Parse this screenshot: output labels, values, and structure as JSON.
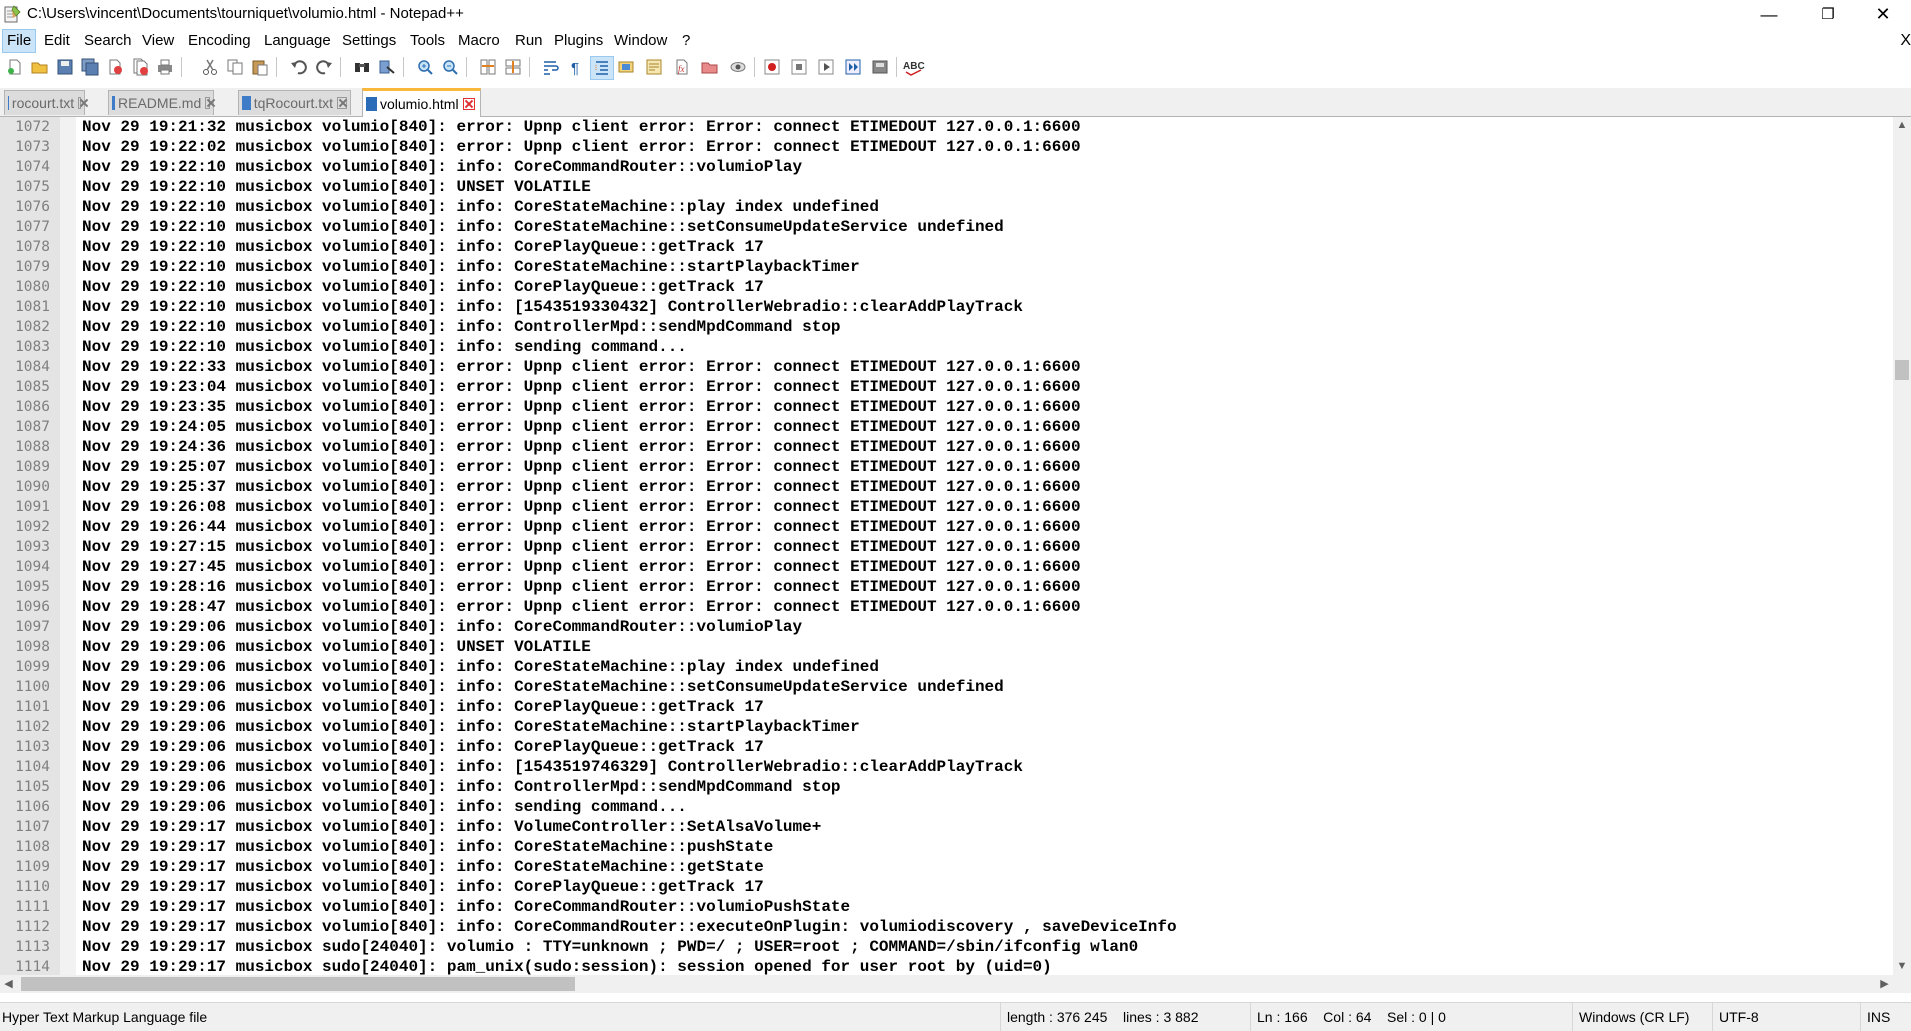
{
  "window": {
    "title": "C:\\Users\\vincent\\Documents\\tourniquet\\volumio.html - Notepad++",
    "minimize": "—",
    "maximize": "❐",
    "close": "✕"
  },
  "menu": {
    "items": [
      "File",
      "Edit",
      "Search",
      "View",
      "Encoding",
      "Language",
      "Settings",
      "Tools",
      "Macro",
      "Run",
      "Plugins",
      "Window",
      "?"
    ],
    "close_doc": "X"
  },
  "toolbar": {
    "icons": [
      "new-file",
      "open-file",
      "save",
      "save-all",
      "close",
      "close-all",
      "print",
      "cut",
      "copy",
      "paste",
      "undo",
      "redo",
      "find",
      "replace",
      "zoom-in",
      "zoom-out",
      "sync-vertical",
      "sync-horizontal",
      "word-wrap",
      "show-all-chars",
      "indent-guide",
      "user-defined-lang",
      "doc-map",
      "function-list",
      "folder-as-workspace",
      "monitoring",
      "record-macro",
      "stop-record",
      "play-macro",
      "run-macro-multiple",
      "save-macro",
      "spell-check"
    ]
  },
  "tabs": [
    {
      "label": "rocourt.txt",
      "active": false
    },
    {
      "label": "README.md",
      "active": false
    },
    {
      "label": "tqRocourt.txt",
      "active": false
    },
    {
      "label": "volumio.html",
      "active": true
    }
  ],
  "editor": {
    "lines": [
      {
        "n": "1072",
        "text": "Nov 29 19:21:32 musicbox volumio[840]: error: Upnp client error: Error: connect ETIMEDOUT 127.0.0.1:6600"
      },
      {
        "n": "1073",
        "text": "Nov 29 19:22:02 musicbox volumio[840]: error: Upnp client error: Error: connect ETIMEDOUT 127.0.0.1:6600"
      },
      {
        "n": "1074",
        "text": "Nov 29 19:22:10 musicbox volumio[840]: info: CoreCommandRouter::volumioPlay"
      },
      {
        "n": "1075",
        "text": "Nov 29 19:22:10 musicbox volumio[840]: UNSET VOLATILE"
      },
      {
        "n": "1076",
        "text": "Nov 29 19:22:10 musicbox volumio[840]: info: CoreStateMachine::play index undefined"
      },
      {
        "n": "1077",
        "text": "Nov 29 19:22:10 musicbox volumio[840]: info: CoreStateMachine::setConsumeUpdateService undefined"
      },
      {
        "n": "1078",
        "text": "Nov 29 19:22:10 musicbox volumio[840]: info: CorePlayQueue::getTrack 17"
      },
      {
        "n": "1079",
        "text": "Nov 29 19:22:10 musicbox volumio[840]: info: CoreStateMachine::startPlaybackTimer"
      },
      {
        "n": "1080",
        "text": "Nov 29 19:22:10 musicbox volumio[840]: info: CorePlayQueue::getTrack 17"
      },
      {
        "n": "1081",
        "text": "Nov 29 19:22:10 musicbox volumio[840]: info: [1543519330432] ControllerWebradio::clearAddPlayTrack"
      },
      {
        "n": "1082",
        "text": "Nov 29 19:22:10 musicbox volumio[840]: info: ControllerMpd::sendMpdCommand stop"
      },
      {
        "n": "1083",
        "text": "Nov 29 19:22:10 musicbox volumio[840]: info: sending command..."
      },
      {
        "n": "1084",
        "text": "Nov 29 19:22:33 musicbox volumio[840]: error: Upnp client error: Error: connect ETIMEDOUT 127.0.0.1:6600"
      },
      {
        "n": "1085",
        "text": "Nov 29 19:23:04 musicbox volumio[840]: error: Upnp client error: Error: connect ETIMEDOUT 127.0.0.1:6600"
      },
      {
        "n": "1086",
        "text": "Nov 29 19:23:35 musicbox volumio[840]: error: Upnp client error: Error: connect ETIMEDOUT 127.0.0.1:6600"
      },
      {
        "n": "1087",
        "text": "Nov 29 19:24:05 musicbox volumio[840]: error: Upnp client error: Error: connect ETIMEDOUT 127.0.0.1:6600"
      },
      {
        "n": "1088",
        "text": "Nov 29 19:24:36 musicbox volumio[840]: error: Upnp client error: Error: connect ETIMEDOUT 127.0.0.1:6600"
      },
      {
        "n": "1089",
        "text": "Nov 29 19:25:07 musicbox volumio[840]: error: Upnp client error: Error: connect ETIMEDOUT 127.0.0.1:6600"
      },
      {
        "n": "1090",
        "text": "Nov 29 19:25:37 musicbox volumio[840]: error: Upnp client error: Error: connect ETIMEDOUT 127.0.0.1:6600"
      },
      {
        "n": "1091",
        "text": "Nov 29 19:26:08 musicbox volumio[840]: error: Upnp client error: Error: connect ETIMEDOUT 127.0.0.1:6600"
      },
      {
        "n": "1092",
        "text": "Nov 29 19:26:44 musicbox volumio[840]: error: Upnp client error: Error: connect ETIMEDOUT 127.0.0.1:6600"
      },
      {
        "n": "1093",
        "text": "Nov 29 19:27:15 musicbox volumio[840]: error: Upnp client error: Error: connect ETIMEDOUT 127.0.0.1:6600"
      },
      {
        "n": "1094",
        "text": "Nov 29 19:27:45 musicbox volumio[840]: error: Upnp client error: Error: connect ETIMEDOUT 127.0.0.1:6600"
      },
      {
        "n": "1095",
        "text": "Nov 29 19:28:16 musicbox volumio[840]: error: Upnp client error: Error: connect ETIMEDOUT 127.0.0.1:6600"
      },
      {
        "n": "1096",
        "text": "Nov 29 19:28:47 musicbox volumio[840]: error: Upnp client error: Error: connect ETIMEDOUT 127.0.0.1:6600"
      },
      {
        "n": "1097",
        "text": "Nov 29 19:29:06 musicbox volumio[840]: info: CoreCommandRouter::volumioPlay"
      },
      {
        "n": "1098",
        "text": "Nov 29 19:29:06 musicbox volumio[840]: UNSET VOLATILE"
      },
      {
        "n": "1099",
        "text": "Nov 29 19:29:06 musicbox volumio[840]: info: CoreStateMachine::play index undefined"
      },
      {
        "n": "1100",
        "text": "Nov 29 19:29:06 musicbox volumio[840]: info: CoreStateMachine::setConsumeUpdateService undefined"
      },
      {
        "n": "1101",
        "text": "Nov 29 19:29:06 musicbox volumio[840]: info: CorePlayQueue::getTrack 17"
      },
      {
        "n": "1102",
        "text": "Nov 29 19:29:06 musicbox volumio[840]: info: CoreStateMachine::startPlaybackTimer"
      },
      {
        "n": "1103",
        "text": "Nov 29 19:29:06 musicbox volumio[840]: info: CorePlayQueue::getTrack 17"
      },
      {
        "n": "1104",
        "text": "Nov 29 19:29:06 musicbox volumio[840]: info: [1543519746329] ControllerWebradio::clearAddPlayTrack"
      },
      {
        "n": "1105",
        "text": "Nov 29 19:29:06 musicbox volumio[840]: info: ControllerMpd::sendMpdCommand stop"
      },
      {
        "n": "1106",
        "text": "Nov 29 19:29:06 musicbox volumio[840]: info: sending command..."
      },
      {
        "n": "1107",
        "text": "Nov 29 19:29:17 musicbox volumio[840]: info: VolumeController::SetAlsaVolume+"
      },
      {
        "n": "1108",
        "text": "Nov 29 19:29:17 musicbox volumio[840]: info: CoreStateMachine::pushState"
      },
      {
        "n": "1109",
        "text": "Nov 29 19:29:17 musicbox volumio[840]: info: CoreStateMachine::getState"
      },
      {
        "n": "1110",
        "text": "Nov 29 19:29:17 musicbox volumio[840]: info: CorePlayQueue::getTrack 17"
      },
      {
        "n": "1111",
        "text": "Nov 29 19:29:17 musicbox volumio[840]: info: CoreCommandRouter::volumioPushState"
      },
      {
        "n": "1112",
        "text": "Nov 29 19:29:17 musicbox volumio[840]: info: CoreCommandRouter::executeOnPlugin: volumiodiscovery , saveDeviceInfo"
      },
      {
        "n": "1113",
        "text": "Nov 29 19:29:17 musicbox sudo[24040]: volumio : TTY=unknown ; PWD=/ ; USER=root ; COMMAND=/sbin/ifconfig wlan0"
      },
      {
        "n": "1114",
        "text": "Nov 29 19:29:17 musicbox sudo[24040]: pam_unix(sudo:session): session opened for user root by (uid=0)"
      }
    ]
  },
  "scrollbars": {
    "up": "▲",
    "down": "▼",
    "left": "◀",
    "right": "▶"
  },
  "statusbar": {
    "file_type": "Hyper Text Markup Language file",
    "length": "length : 376 245",
    "lines": "lines : 3 882",
    "ln": "Ln : 166",
    "col": "Col : 64",
    "sel": "Sel : 0 | 0",
    "eol": "Windows (CR LF)",
    "encoding": "UTF-8",
    "mode": "INS"
  }
}
